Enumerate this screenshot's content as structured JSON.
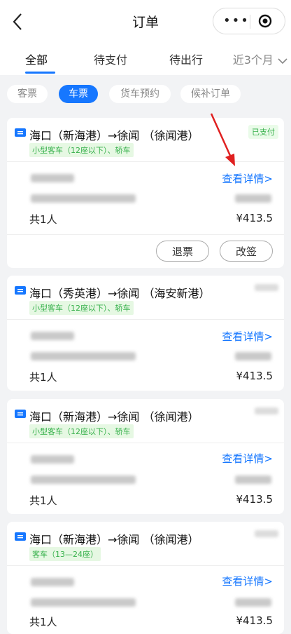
{
  "header": {
    "title": "订单",
    "more_icon": "more-dots-icon",
    "close_icon": "target-icon",
    "back_icon": "chevron-left-icon"
  },
  "tabs": [
    {
      "label": "全部",
      "active": true
    },
    {
      "label": "待支付",
      "active": false
    },
    {
      "label": "待出行",
      "active": false
    },
    {
      "label": "近3个月",
      "active": false
    }
  ],
  "chips": [
    {
      "label": "客票",
      "active": false
    },
    {
      "label": "车票",
      "active": true
    },
    {
      "label": "货车预约",
      "active": false
    },
    {
      "label": "候补订单",
      "active": false
    }
  ],
  "orders": [
    {
      "route": "海口（新海港）→徐闻 （徐闻港）",
      "vehicle_type": "小型客车（12座以下）、轿车",
      "status": "已支付",
      "detail_label": "查看详情>",
      "count": "共1人",
      "price": "¥413.5",
      "actions": [
        "退票",
        "改签"
      ]
    },
    {
      "route": "海口（秀英港）→徐闻 （海安新港）",
      "vehicle_type": "小型客车（12座以下）、轿车",
      "detail_label": "查看详情>",
      "count": "共1人",
      "price": "¥413.5"
    },
    {
      "route": "海口（新海港）→徐闻 （徐闻港）",
      "vehicle_type": "小型客车（12座以下）、轿车",
      "detail_label": "查看详情>",
      "count": "共1人",
      "price": "¥413.5"
    },
    {
      "route": "海口（新海港）→徐闻 （徐闻港）",
      "vehicle_type": "客车（13—24座）",
      "detail_label": "查看详情>",
      "count": "共1人",
      "price": "¥413.5"
    }
  ],
  "colors": {
    "accent": "#1677ff",
    "success": "#35b04a",
    "annotation_arrow": "#e02020"
  }
}
